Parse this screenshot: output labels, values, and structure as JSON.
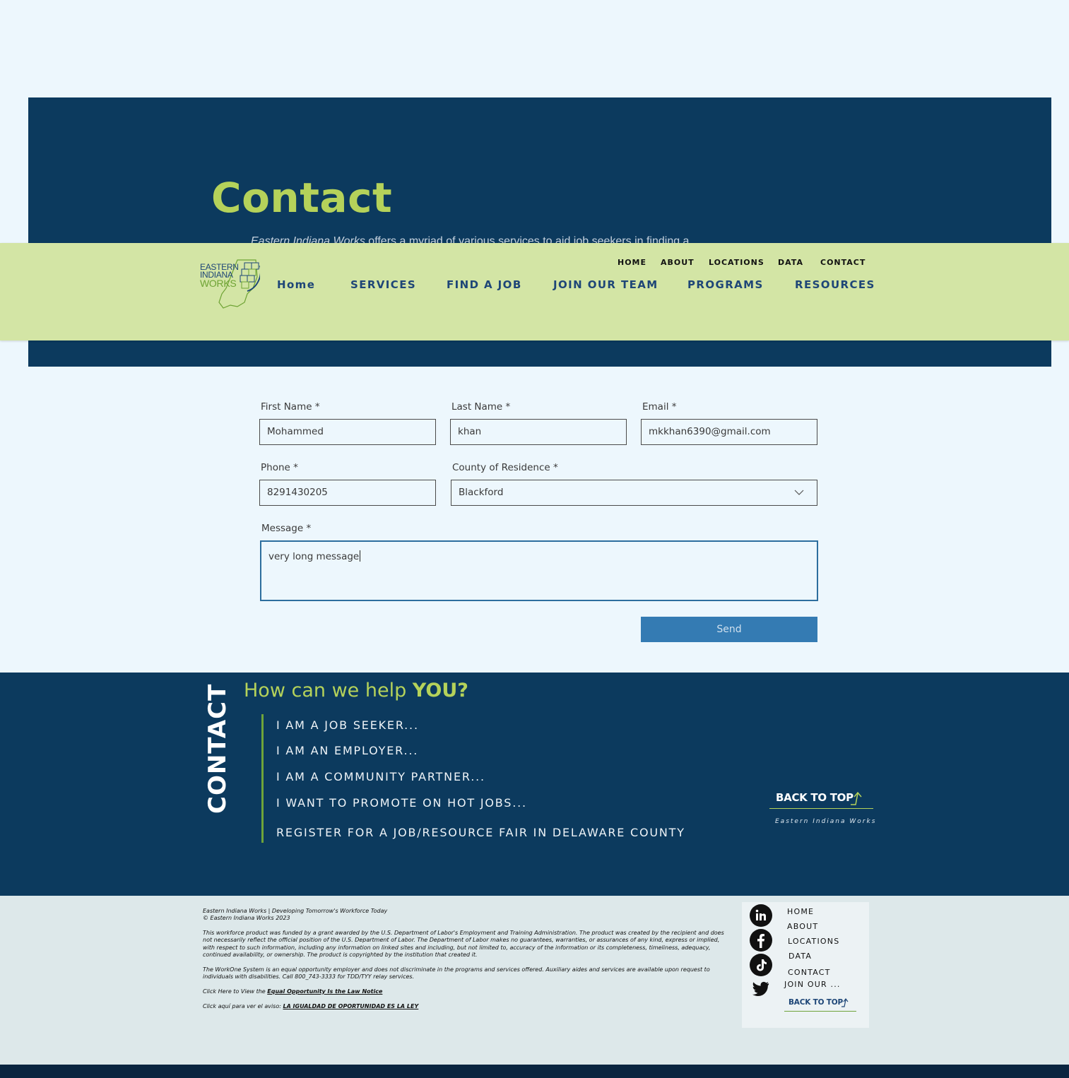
{
  "hero": {
    "title": "Contact",
    "subtitle_brand": "Eastern Indiana Works",
    "subtitle_rest": " offers a myriad of various services to aid job seekers in finding a"
  },
  "logo": {
    "line1": "EASTERN",
    "line2": "INDIANA",
    "line3": "WORKS"
  },
  "top_nav": [
    "HOME",
    "ABOUT",
    "LOCATIONS",
    "DATA",
    "CONTACT"
  ],
  "main_nav": [
    "Home",
    "SERVICES",
    "FIND A JOB",
    "JOIN OUR TEAM",
    "PROGRAMS",
    "RESOURCES"
  ],
  "form": {
    "first_name": {
      "label": "First Name *",
      "value": "Mohammed"
    },
    "last_name": {
      "label": "Last Name *",
      "value": "khan"
    },
    "email": {
      "label": "Email *",
      "value": "mkkhan6390@gmail.com"
    },
    "phone": {
      "label": "Phone *",
      "value": "8291430205"
    },
    "county": {
      "label": "County of Residence *",
      "value": "Blackford"
    },
    "message": {
      "label": "Message *",
      "value": "very long message"
    },
    "send_label": "Send"
  },
  "help": {
    "vertical_label": "CONTACT",
    "title_prefix": "How can we help ",
    "title_bold": "YOU?",
    "items": [
      "I AM A JOB SEEKER...",
      "I AM AN EMPLOYER...",
      "I AM A COMMUNITY PARTNER...",
      "I WANT TO PROMOTE ON HOT JOBS...",
      "REGISTER FOR A JOB/RESOURCE FAIR IN DELAWARE COUNTY"
    ],
    "back_to_top": "BACK TO TOP",
    "org_name": "Eastern Indiana Works"
  },
  "footer": {
    "line1": "Eastern Indiana Works | Developing Tomorrow's Workforce Today",
    "line2": "© Eastern Indiana Works 2023",
    "para1": "This workforce product was funded by a grant awarded by the U.S. Department of Labor's Employment and Training Administration. The product was created by the recipient and does not necessarily reflect the official position of the U.S. Department of Labor. The Department of Labor makes no guarantees, warranties, or assurances of any kind, express or implied, with respect to such information, including any information on linked sites and including, but not limited to, accuracy of the information or its completeness, timeliness, adequacy, continued availability, or ownership. The product is copyrighted by the institution that created it.",
    "para2": "The WorkOne System is an equal opportunity employer and does not discriminate in the programs and services offered. Auxiliary aides and services are available upon request to individuals with disabilities. Call 800_743-3333 for TDD/TYY relay services.",
    "link1_prefix": "Click Here to View the ",
    "link1_text": "Equal Opportunity Is the Law Notice",
    "link2_prefix": "Click aquí para ver el aviso: ",
    "link2_text": "LA IGUALDAD DE OPORTUNIDAD ES LA LEY",
    "nav": [
      "HOME",
      "ABOUT",
      "LOCATIONS",
      "DATA",
      "CONTACT",
      "JOIN OUR ..."
    ],
    "back_to_top": "BACK TO TOP",
    "social": [
      "linkedin-icon",
      "facebook-icon",
      "tiktok-icon",
      "twitter-icon"
    ]
  },
  "colors": {
    "navy": "#0c3a5e",
    "lime": "#b5d25a",
    "header_green": "#d3e5a5",
    "button_blue": "#347bb3",
    "page_bg": "#edf7fd"
  }
}
